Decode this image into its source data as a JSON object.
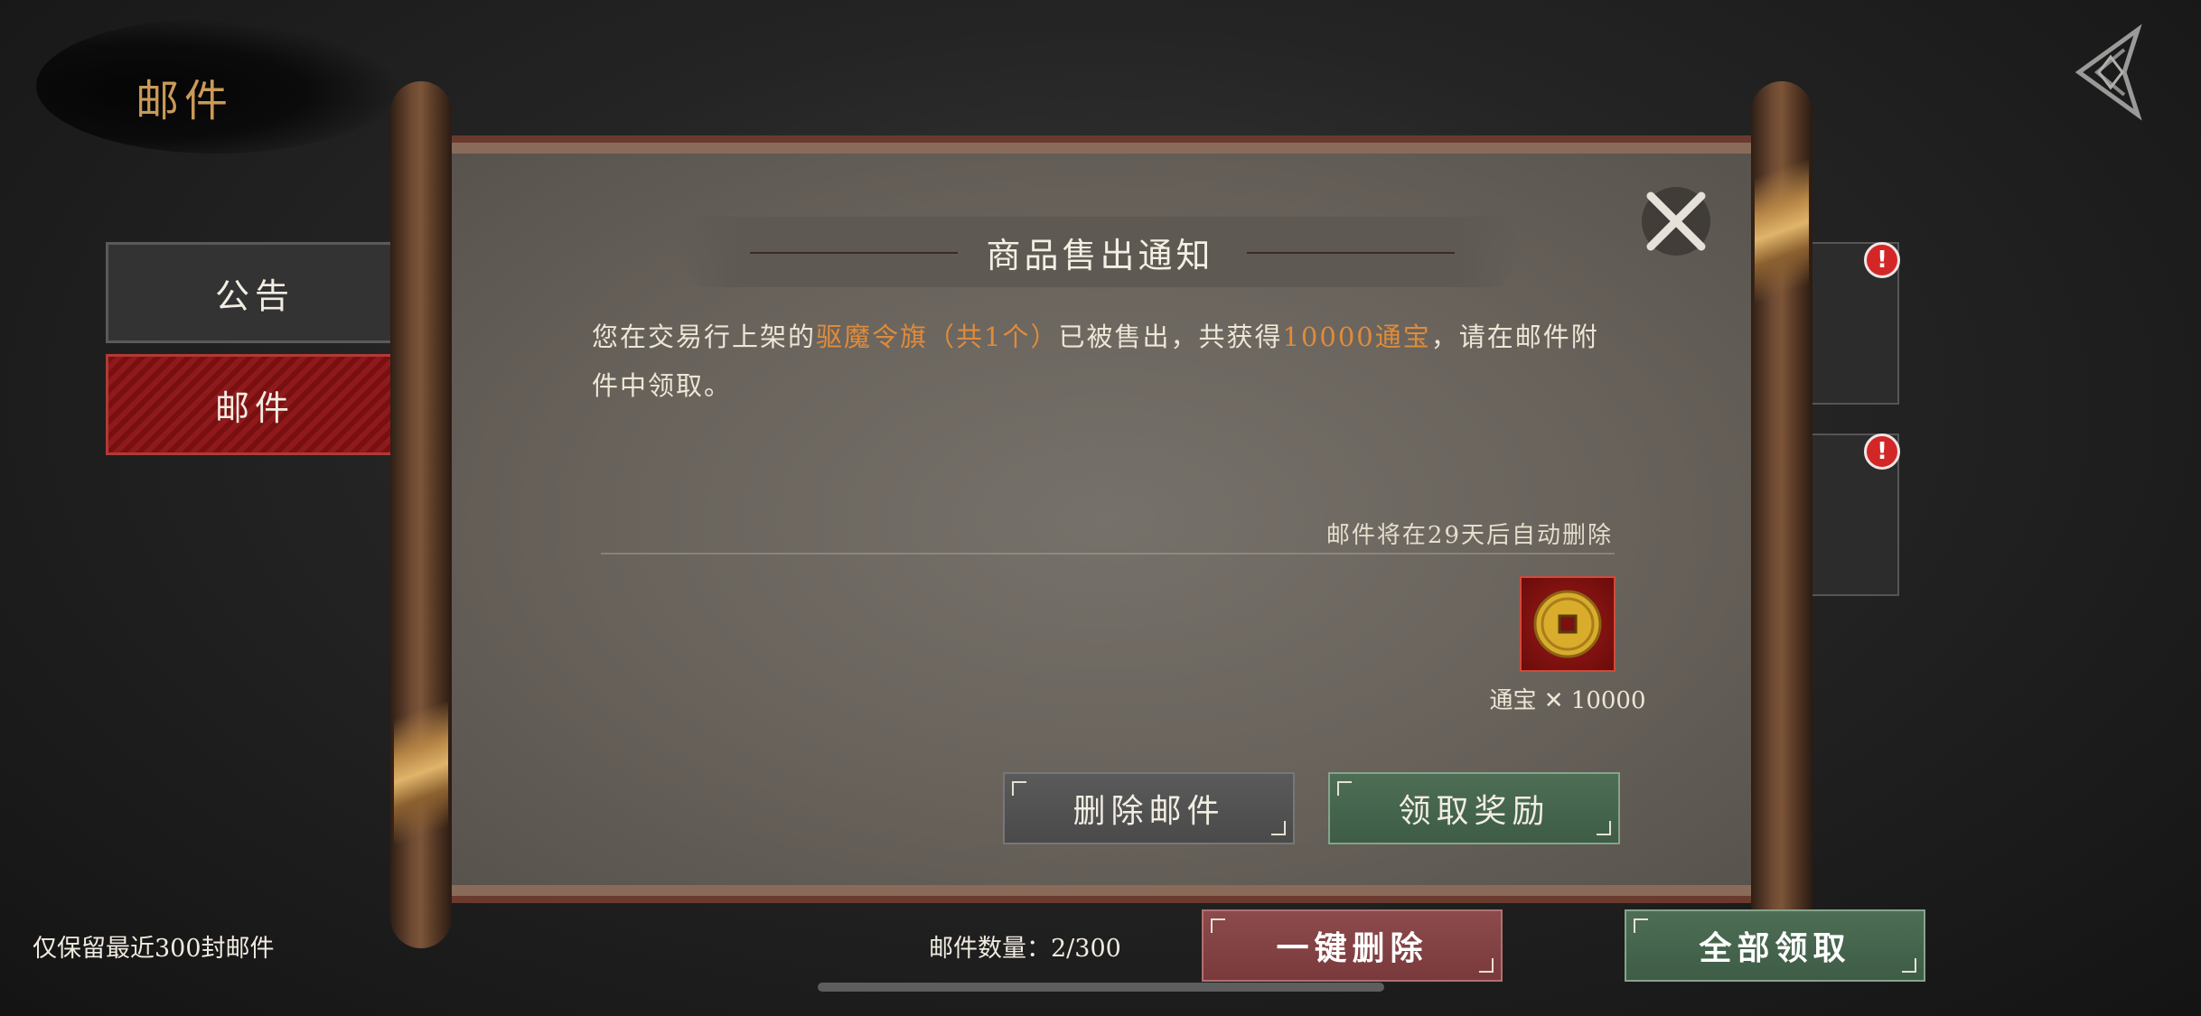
{
  "header": {
    "title": "邮件",
    "back_icon": "back-arrow-icon"
  },
  "sidebar": {
    "tabs": [
      {
        "label": "公告",
        "active": false
      },
      {
        "label": "邮件",
        "active": true
      }
    ]
  },
  "mail_list": {
    "badge_symbol": "!",
    "badge_color": "#d32727"
  },
  "dialog": {
    "title": "商品售出通知",
    "message": {
      "part1": "您在交易行上架的",
      "item_highlight": "驱魔令旗（共1个）",
      "part2": "已被售出，共获得",
      "amount_highlight": "10000通宝",
      "part3": "，请在邮件附件中领取。"
    },
    "highlight_color": "#e08b3a",
    "expire_text": "邮件将在29天后自动删除",
    "attachment": {
      "icon": "copper-coin-icon",
      "label": "通宝 ✕ 10000"
    },
    "delete_button": "删除邮件",
    "claim_button": "领取奖励"
  },
  "footer": {
    "keep_note": "仅保留最近300封邮件",
    "mail_count": "邮件数量：2/300",
    "delete_all_button": "一键删除",
    "claim_all_button": "全部领取"
  }
}
